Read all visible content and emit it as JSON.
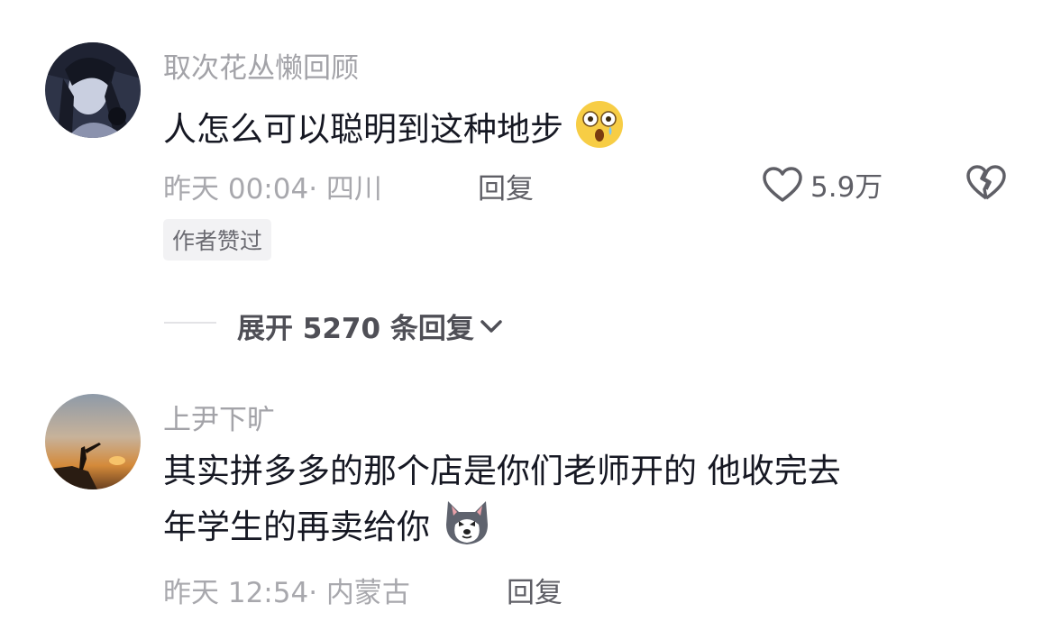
{
  "comments": [
    {
      "username": "取次花丛懒回顾",
      "text_lines": [
        "人怎么可以聪明到这种地步"
      ],
      "emoji": "shocked-face-emoji",
      "time": "昨天 00:04",
      "location": "四川",
      "reply_label": "回复",
      "like_count": "5.9万",
      "badge": "作者赞过",
      "expand_label": "展开 5270 条回复"
    },
    {
      "username": "上尹下旷",
      "text_lines": [
        "其实拼多多的那个店是你们老师开的  他收完去",
        "年学生的再卖给你"
      ],
      "emoji": "husky-dog-emoji",
      "time": "昨天 12:54",
      "location": "内蒙古",
      "reply_label": "回复"
    }
  ],
  "colors": {
    "username": "#a3a3a8",
    "text": "#161823",
    "meta": "#a8a8ad",
    "action": "#5f5f66"
  }
}
